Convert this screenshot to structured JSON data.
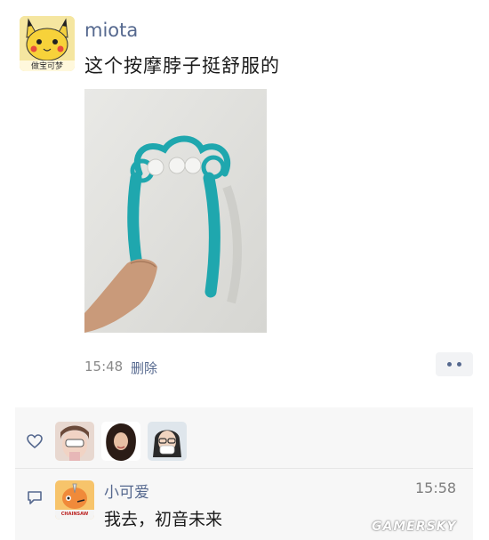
{
  "post": {
    "username": "miota",
    "avatar_caption": "做宝可梦",
    "text": "这个按摩脖子挺舒服的",
    "time": "15:48",
    "delete_label": "删除",
    "more_icon": "more-dots-icon"
  },
  "likes": {
    "icon": "heart-icon",
    "avatars": [
      "liker-avatar-1",
      "liker-avatar-2",
      "liker-avatar-3"
    ]
  },
  "comment": {
    "icon": "comment-icon",
    "name": "小可爱",
    "time": "15:58",
    "text": "我去，初音未来",
    "avatar_caption": "CHAINSAW MAN"
  },
  "watermark": "GAMERSKY",
  "colors": {
    "link": "#56698f",
    "panel": "#f7f7f7",
    "massager": "#1fa7ae"
  }
}
